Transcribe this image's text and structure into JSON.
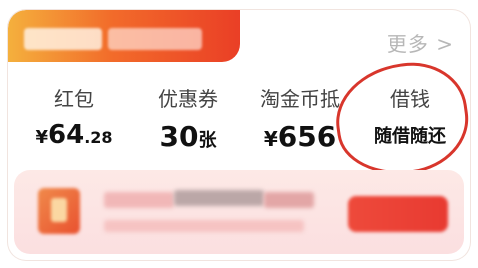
{
  "header": {
    "more_label": "更多 >"
  },
  "stats": {
    "items": [
      {
        "label": "红包",
        "value_currency": "¥",
        "value_int": "64",
        "value_dec": ".28"
      },
      {
        "label": "优惠券",
        "value_num": "30",
        "value_unit": "张"
      },
      {
        "label": "淘金币抵",
        "value_currency": "¥",
        "value_num": "656"
      },
      {
        "label": "借钱",
        "value_text": "随借随还"
      }
    ]
  },
  "annotation": {
    "circle_color": "#d8362c"
  },
  "colors": {
    "header_gradient_start": "#f4b03d",
    "header_gradient_end": "#ea3f26",
    "banner_bg": "#fde9e6",
    "accent_red": "#e83a31"
  },
  "icons": {
    "more_icon": "chevron-right-icon",
    "banner_icon": "coupon-icon"
  }
}
